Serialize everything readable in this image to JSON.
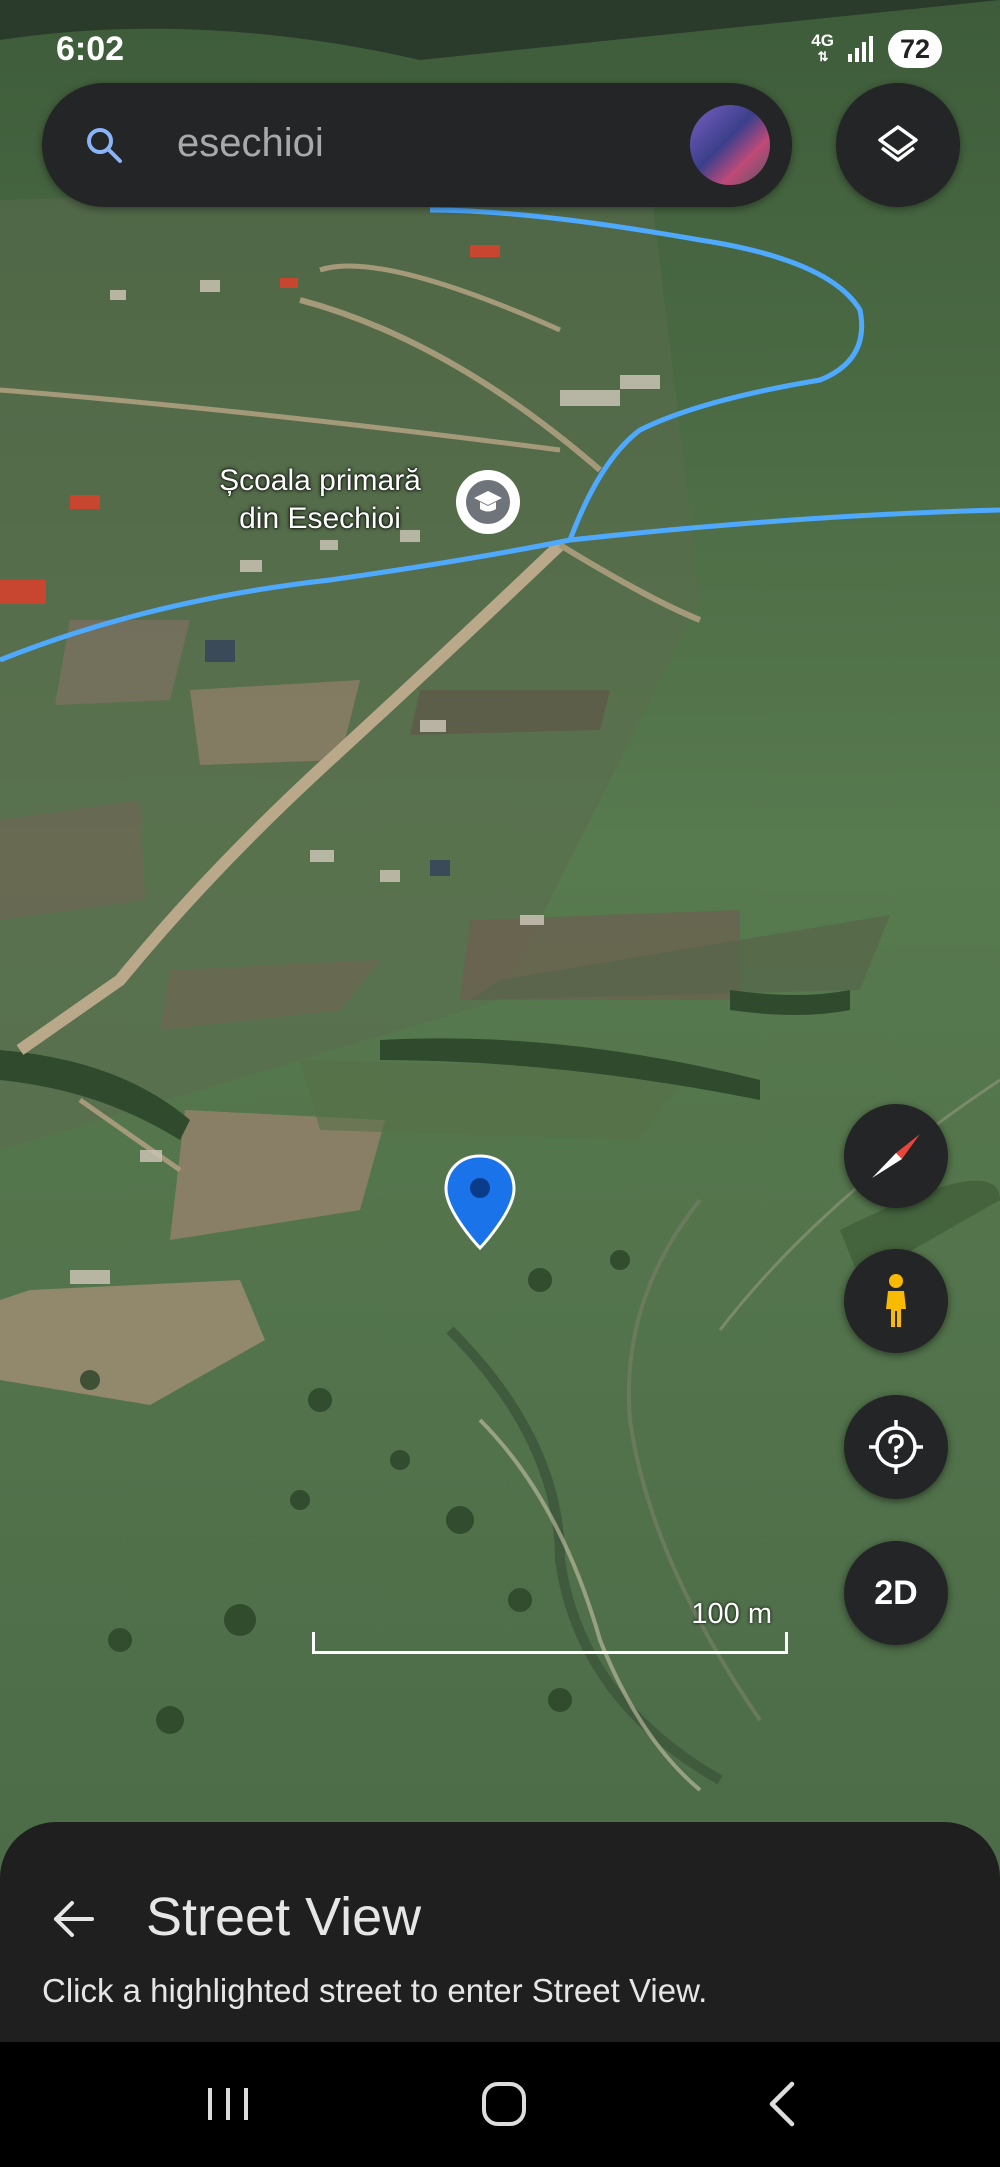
{
  "status_bar": {
    "time": "6:02",
    "network": "4G",
    "battery": "72"
  },
  "search": {
    "query": "esechioi"
  },
  "map": {
    "place_label_line1": "Școala primară",
    "place_label_line2": "din Esechioi",
    "scale_label": "100 m",
    "toggle_view_label": "2D"
  },
  "street_view_sheet": {
    "title": "Street View",
    "message": "Click a highlighted street to enter Street View."
  },
  "colors": {
    "road_highlight": "#4ea9ff",
    "pin": "#1a73e8",
    "pegman": "#f9ba00",
    "compass_red": "#e8453c",
    "sheet_background": "#1f1f1f"
  },
  "icons": {
    "search": "search-icon",
    "layers": "layers-icon",
    "school": "school-icon",
    "compass": "compass-icon",
    "pegman": "pegman-icon",
    "help_location": "help-location-icon",
    "back": "arrow-left-icon"
  }
}
